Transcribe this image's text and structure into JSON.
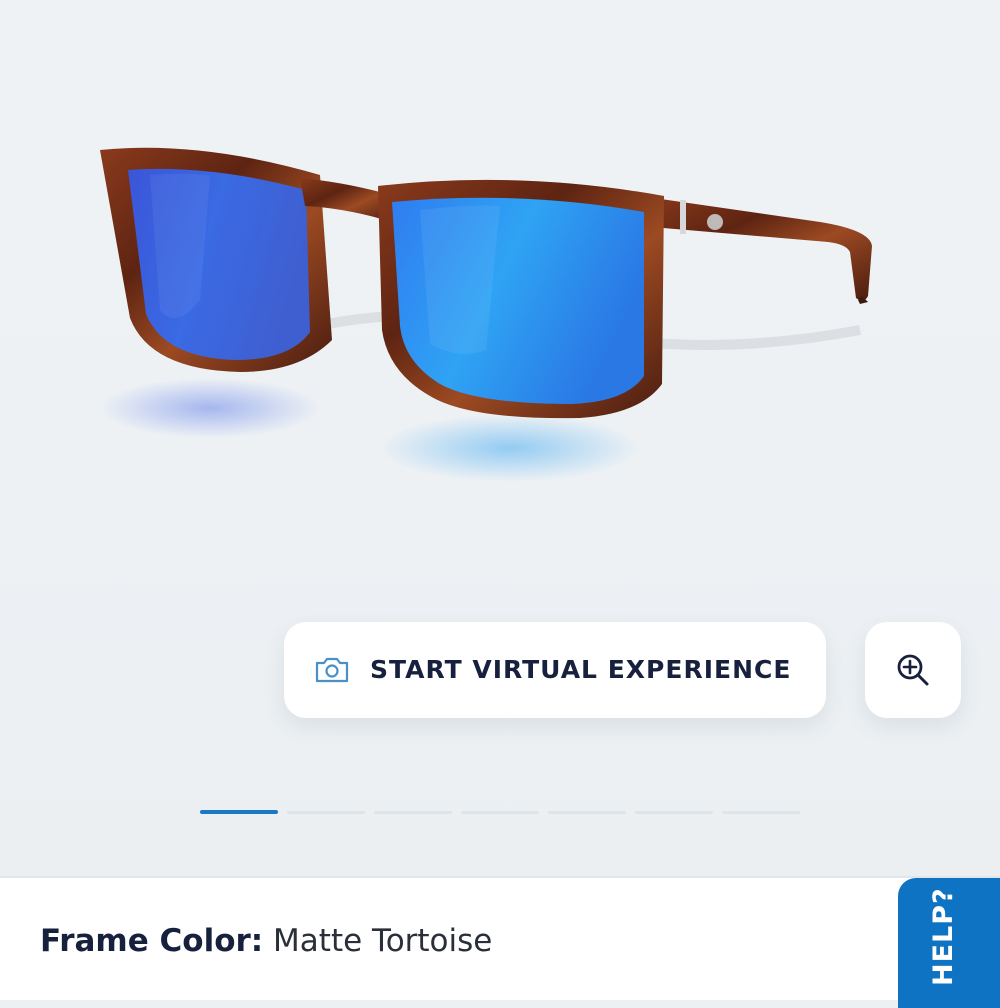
{
  "gallery": {
    "image_alt": "Matte Tortoise sunglasses with blue mirror lenses",
    "total_slides": 7,
    "active_slide": 1
  },
  "vto_button": {
    "label": "START VIRTUAL EXPERIENCE",
    "icon": "camera-icon"
  },
  "zoom_button": {
    "icon": "zoom-in-icon"
  },
  "product": {
    "frame_color_label": "Frame Color:",
    "frame_color_value": "Matte Tortoise"
  },
  "help_tab": {
    "label": "HELP?"
  },
  "colors": {
    "accent": "#1a79c6",
    "help_bg": "#0d73c2",
    "text_dark": "#17213d"
  }
}
